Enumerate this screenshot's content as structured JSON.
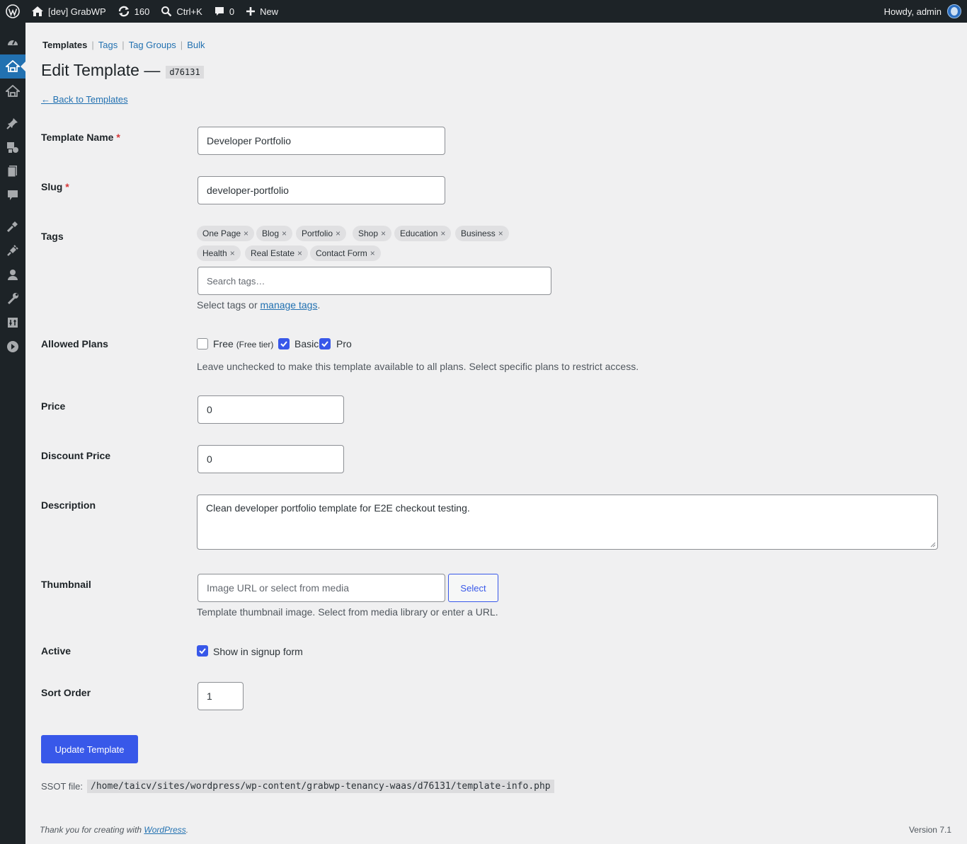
{
  "adminbar": {
    "site_name": "[dev] GrabWP",
    "updates_count": "160",
    "search_shortcut": "Ctrl+K",
    "comments_count": "0",
    "new_label": "New",
    "howdy": "Howdy, admin"
  },
  "sidebar": {
    "icons": [
      "dashboard-icon",
      "templates-icon",
      "sites-icon",
      "posts-icon",
      "media-icon",
      "pages-icon",
      "comments-icon",
      "appearance-icon",
      "plugins-icon",
      "users-icon",
      "tools-icon",
      "settings-icon",
      "collapse-icon"
    ],
    "active_index": 1
  },
  "subnav": {
    "current": "Templates",
    "links": [
      "Tags",
      "Tag Groups",
      "Bulk"
    ]
  },
  "page": {
    "title": "Edit Template —",
    "template_id": "d76131",
    "back_link": "← Back to Templates"
  },
  "form": {
    "name": {
      "label": "Template Name",
      "required": "*",
      "value": "Developer Portfolio"
    },
    "slug": {
      "label": "Slug",
      "required": "*",
      "value": "developer-portfolio"
    },
    "tags": {
      "label": "Tags",
      "selected": [
        "One Page",
        "Blog",
        "Portfolio",
        "Shop",
        "Education",
        "Business",
        "Health",
        "Real Estate",
        "Contact Form"
      ],
      "remove_glyph": "×",
      "search_placeholder": "Search tags…",
      "help_prefix": "Select tags or ",
      "help_link": "manage tags",
      "help_suffix": "."
    },
    "plans": {
      "label": "Allowed Plans",
      "options": [
        {
          "label": "Free",
          "note": "(Free tier)",
          "checked": false
        },
        {
          "label": "Basic",
          "checked": true
        },
        {
          "label": "Pro",
          "checked": true
        }
      ],
      "help": "Leave unchecked to make this template available to all plans. Select specific plans to restrict access."
    },
    "price": {
      "label": "Price",
      "value": "0"
    },
    "discount_price": {
      "label": "Discount Price",
      "value": "0"
    },
    "description": {
      "label": "Description",
      "value": "Clean developer portfolio template for E2E checkout testing."
    },
    "thumbnail": {
      "label": "Thumbnail",
      "placeholder": "Image URL or select from media",
      "select_button": "Select",
      "help": "Template thumbnail image. Select from media library or enter a URL."
    },
    "active": {
      "label": "Active",
      "checkbox_label": "Show in signup form",
      "checked": true
    },
    "sort_order": {
      "label": "Sort Order",
      "value": "1"
    },
    "submit": "Update Template"
  },
  "ssot": {
    "label": "SSOT file:",
    "path": "/home/taicv/sites/wordpress/wp-content/grabwp-tenancy-waas/d76131/template-info.php"
  },
  "footer": {
    "thanks_prefix": "Thank you for creating with ",
    "thanks_link": "WordPress",
    "thanks_suffix": ".",
    "version": "Version 7.1"
  },
  "colors": {
    "adminbar_bg": "#1d2327",
    "accent": "#3858e9",
    "link": "#2271b1",
    "page_bg": "#f0f0f1",
    "required": "#d63638"
  }
}
